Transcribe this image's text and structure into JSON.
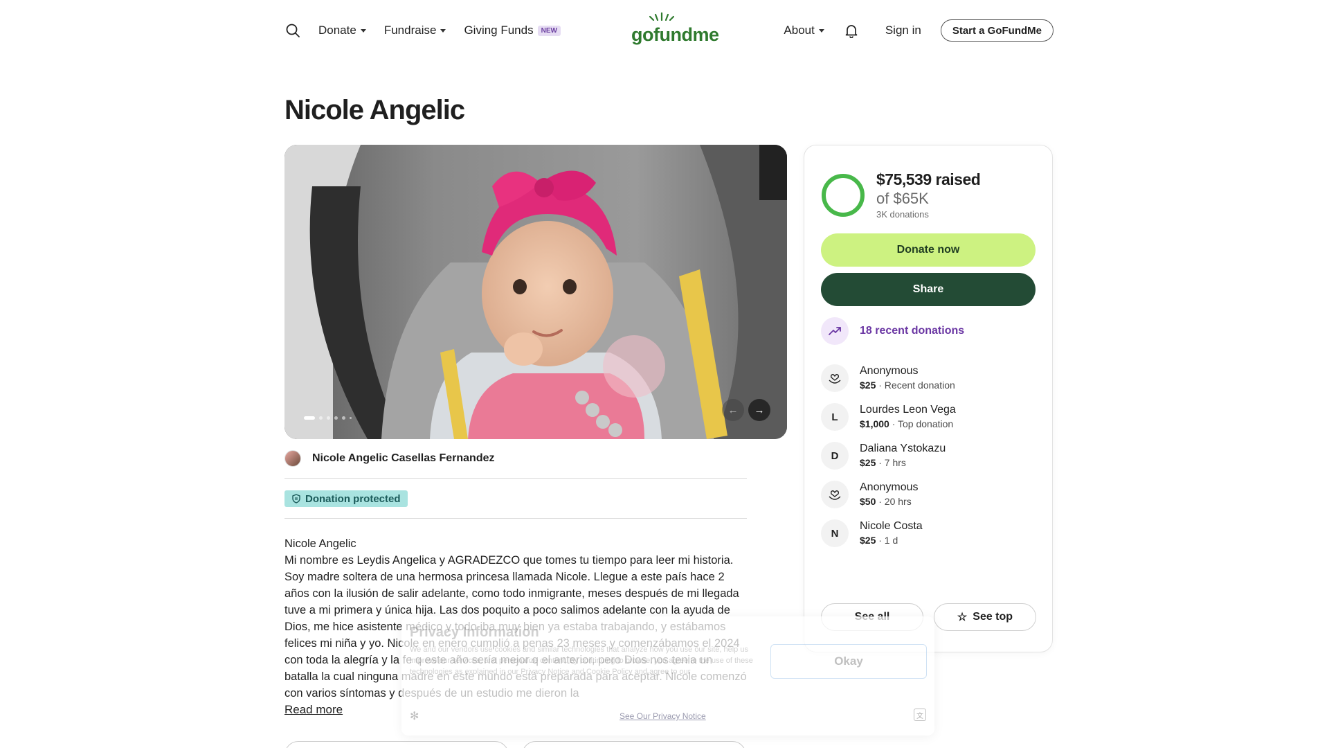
{
  "nav": {
    "donate": "Donate",
    "fundraise": "Fundraise",
    "giving_funds": "Giving Funds",
    "new_badge": "NEW",
    "logo": "gofundme",
    "about": "About",
    "sign_in": "Sign in",
    "start": "Start a GoFundMe"
  },
  "campaign": {
    "title": "Nicole Angelic",
    "organizer": "Nicole Angelic Casellas Fernandez",
    "protected_label": "Donation protected",
    "story_title": "Nicole Angelic",
    "story": "Mi nombre es Leydis Angelica y AGRADEZCO que tomes tu tiempo para leer mi historia. Soy madre soltera de una hermosa princesa llamada Nicole. Llegue a este país hace 2 años con la ilusión de salir adelante, como todo inmigrante, meses después de mi llegada tuve a mi primera y única hija. Las dos poquito a poco salimos adelante con la ayuda de Dios, me hice asistente médico y todo iba muy bien ya estaba trabajando, y estábamos felices mi niña y yo. Nicole en enero cumplió a penas 23 meses y comenzábamos el 2024 con toda la alegría y la fe q este año sería mejor q el anterior, pero Dios nos tenia un batalla la cual ninguna madre en este mundo está preparada para aceptar. Nicole comenzó con varios síntomas y después de un estudio me dieron la",
    "read_more": "Read more",
    "photo_slide_index": 1,
    "photo_slide_total": 6
  },
  "donation_card": {
    "raised": "$75,539 raised",
    "goal": "of $65K",
    "donations": "3K donations",
    "progress_fraction": 1.0,
    "donate_now": "Donate now",
    "share": "Share",
    "recent_label": "18 recent donations",
    "donors": [
      {
        "initial": "",
        "name": "Anonymous",
        "amount": "$25",
        "note": " · Recent donation"
      },
      {
        "initial": "L",
        "name": "Lourdes Leon Vega",
        "amount": "$1,000",
        "note": " · Top donation"
      },
      {
        "initial": "D",
        "name": "Daliana Ystokazu",
        "amount": "$25",
        "note": " · 7 hrs"
      },
      {
        "initial": "",
        "name": "Anonymous",
        "amount": "$50",
        "note": " · 20 hrs"
      },
      {
        "initial": "N",
        "name": "Nicole Costa",
        "amount": "$25",
        "note": " · 1 d"
      }
    ],
    "see_all": "See all",
    "see_top": "See top"
  },
  "privacy": {
    "title": "Privacy Information",
    "body": "We and our vendors use cookies and similar technologies that analyze how you use our site, help us improve our services, and personalize content. By continuing to browse, you agree to the use of these technologies as explained in our Privacy Notice and Cookie Policy and agree to our",
    "okay": "Okay",
    "link": "See Our Privacy Notice"
  },
  "colors": {
    "brand_green": "#2f7a2e",
    "donate_btn": "#cdf281",
    "share_btn": "#234b35",
    "recent_purple": "#6a36a3",
    "protected_bg": "#a9e3e0"
  }
}
